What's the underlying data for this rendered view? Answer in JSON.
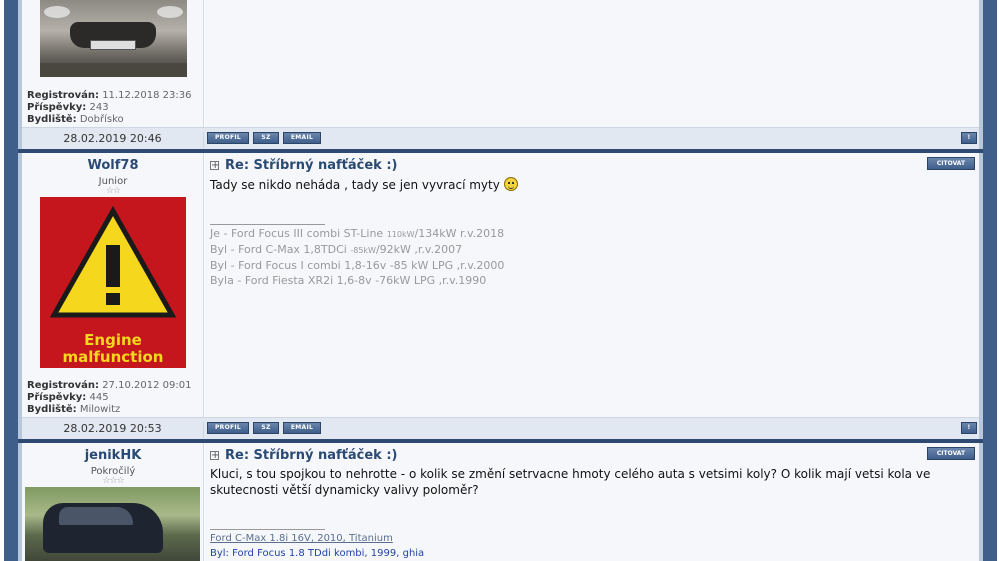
{
  "posts": [
    {
      "registered_label": "Registrován:",
      "registered": "11.12.2018 23:36",
      "posts_label": "Příspěvky:",
      "posts": "243",
      "location_label": "Bydliště:",
      "location": "Dobřísko",
      "date": "28.02.2019 20:46"
    },
    {
      "username": "Wolf78",
      "rank": "Junior",
      "avatar_text": [
        "Engine",
        "malfunction"
      ],
      "subject": "Re: Stříbrný nafťáček :)",
      "message": "Tady se nikdo neháda , tady se jen vyvrací myty",
      "signature": [
        {
          "a": "Je - Ford Focus III combi ST-Line ",
          "s": "110kW",
          "b": "/134kW r.v.2018"
        },
        {
          "a": "Byl - Ford C-Max 1,8TDCi ",
          "s": "-85kW",
          "b": "/92kW ,r.v.2007"
        },
        {
          "a": "Byl - Ford Focus I combi 1,8-16v -85 kW LPG ,r.v.2000",
          "s": "",
          "b": ""
        },
        {
          "a": "Byla - Ford Fiesta XR2i 1,6-8v -76kW LPG ,r.v.1990",
          "s": "",
          "b": ""
        }
      ],
      "registered_label": "Registrován:",
      "registered": "27.10.2012 09:01",
      "posts_label": "Příspěvky:",
      "posts": "445",
      "location_label": "Bydliště:",
      "location": "Milowitz",
      "date": "28.02.2019 20:53"
    },
    {
      "username": "jenikHK",
      "rank": "Pokročilý",
      "subject": "Re: Stříbrný nafťáček :)",
      "message": "Kluci, s tou spojkou to nehrotte - o kolik se změní setrvacne hmoty celého auta s vetsimi koly? O kolik mají vetsi kola ve skutecnosti větší dynamicky valivy poloměr?",
      "signature_link": "Ford C-Max 1.8i 16V, 2010, Titanium",
      "signature_line2": "Byl: Ford Focus 1.8 TDdi kombi, 1999, ghia"
    }
  ],
  "buttons": {
    "profile": "PROFIL",
    "pm": "SZ",
    "email": "EMAIL",
    "quote": "CITOVAT",
    "top": "!"
  },
  "colors": {
    "frame": "#3f5f8a",
    "separator": "#2e4a72",
    "username": "#2a4a74"
  }
}
